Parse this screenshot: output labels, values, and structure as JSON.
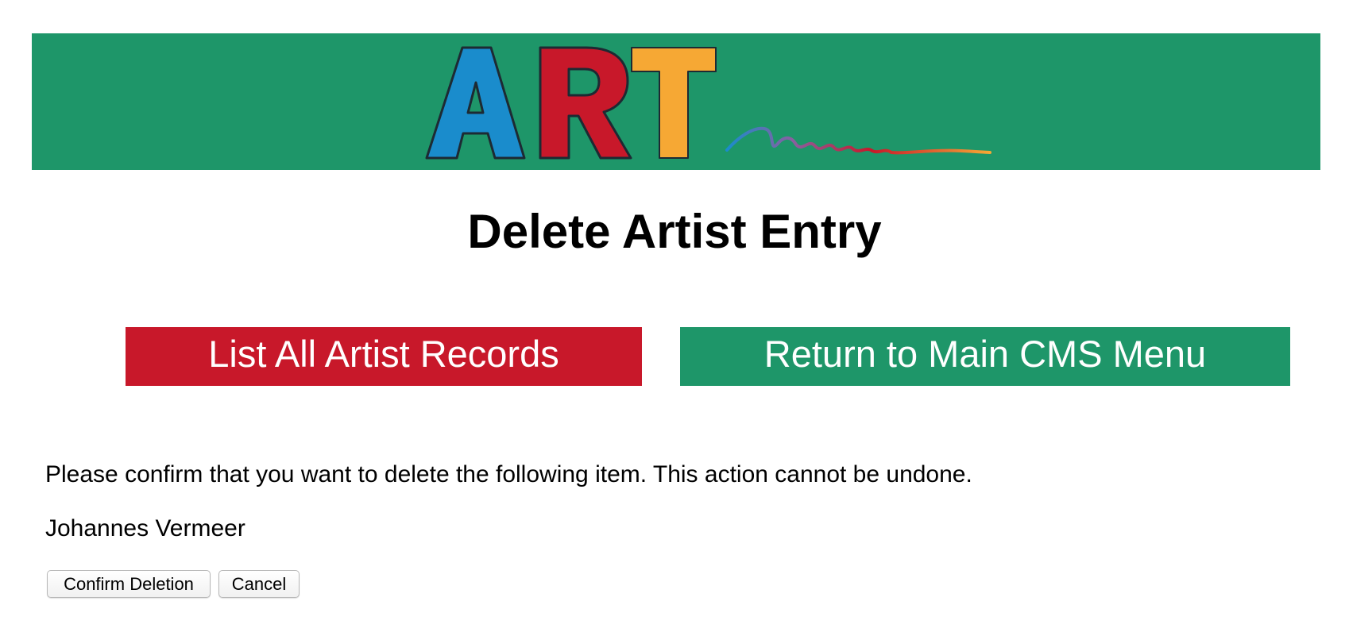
{
  "header": {
    "logo_text": "ART",
    "colors": {
      "banner": "#1e9669",
      "logo_a": "#1a8ccc",
      "logo_r": "#c8182a",
      "logo_t": "#f6a834"
    }
  },
  "page": {
    "title": "Delete Artist Entry"
  },
  "nav": {
    "list_label": "List All Artist Records",
    "return_label": "Return to Main CMS Menu",
    "list_color": "#c8182a",
    "return_color": "#1e9669"
  },
  "confirm": {
    "message": "Please confirm that you want to delete the following item. This action cannot be undone.",
    "item_name": "Johannes Vermeer",
    "confirm_label": "Confirm Deletion",
    "cancel_label": "Cancel"
  }
}
